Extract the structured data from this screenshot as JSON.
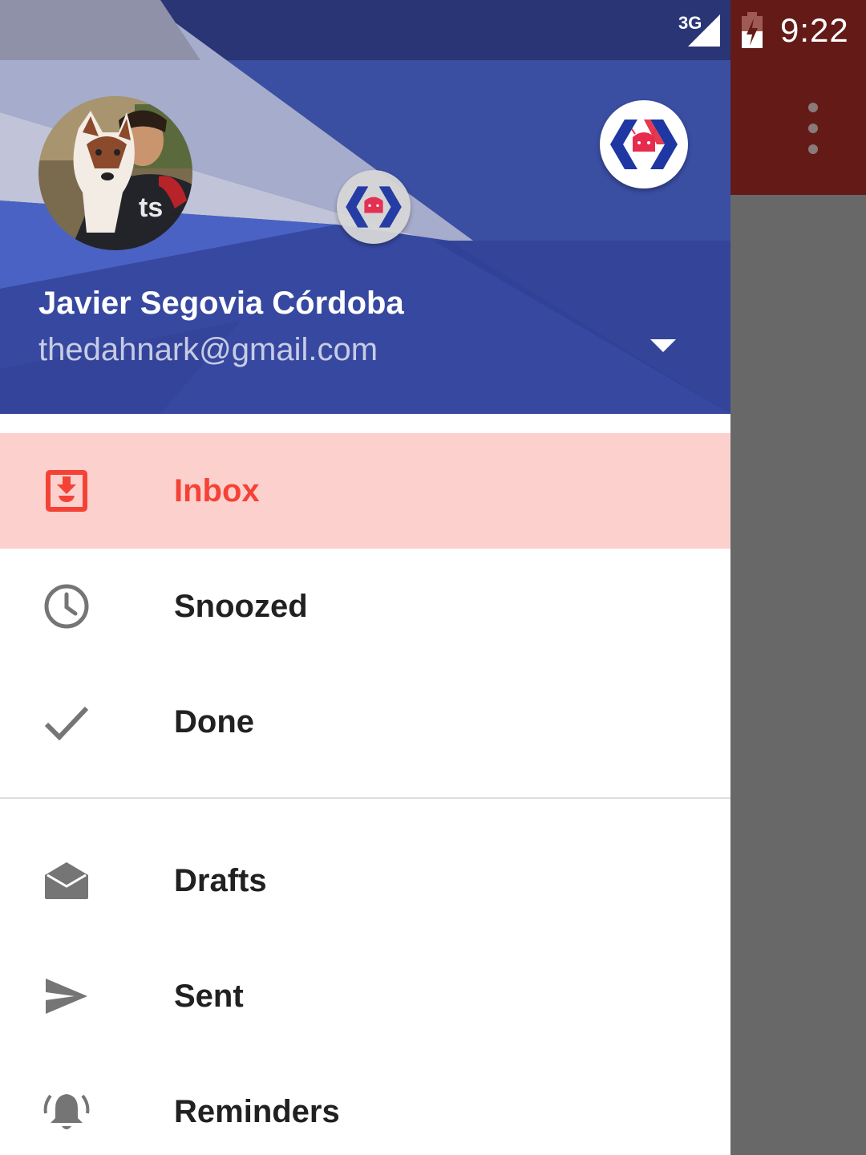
{
  "status_bar": {
    "network": "3G",
    "time": "9:22"
  },
  "account": {
    "name": "Javier Segovia Córdoba",
    "email": "thedahnark@gmail.com"
  },
  "nav": {
    "primary": [
      {
        "label": "Inbox",
        "icon": "inbox-icon",
        "active": true
      },
      {
        "label": "Snoozed",
        "icon": "clock-icon",
        "active": false
      },
      {
        "label": "Done",
        "icon": "check-icon",
        "active": false
      }
    ],
    "secondary": [
      {
        "label": "Drafts",
        "icon": "drafts-icon",
        "active": false
      },
      {
        "label": "Sent",
        "icon": "send-icon",
        "active": false
      },
      {
        "label": "Reminders",
        "icon": "bell-icon",
        "active": false
      }
    ]
  },
  "colors": {
    "header_blue": "#3a4ea2",
    "active_bg": "#fcd0cd",
    "active_text": "#f44336",
    "app_toolbar": "#641b18"
  }
}
